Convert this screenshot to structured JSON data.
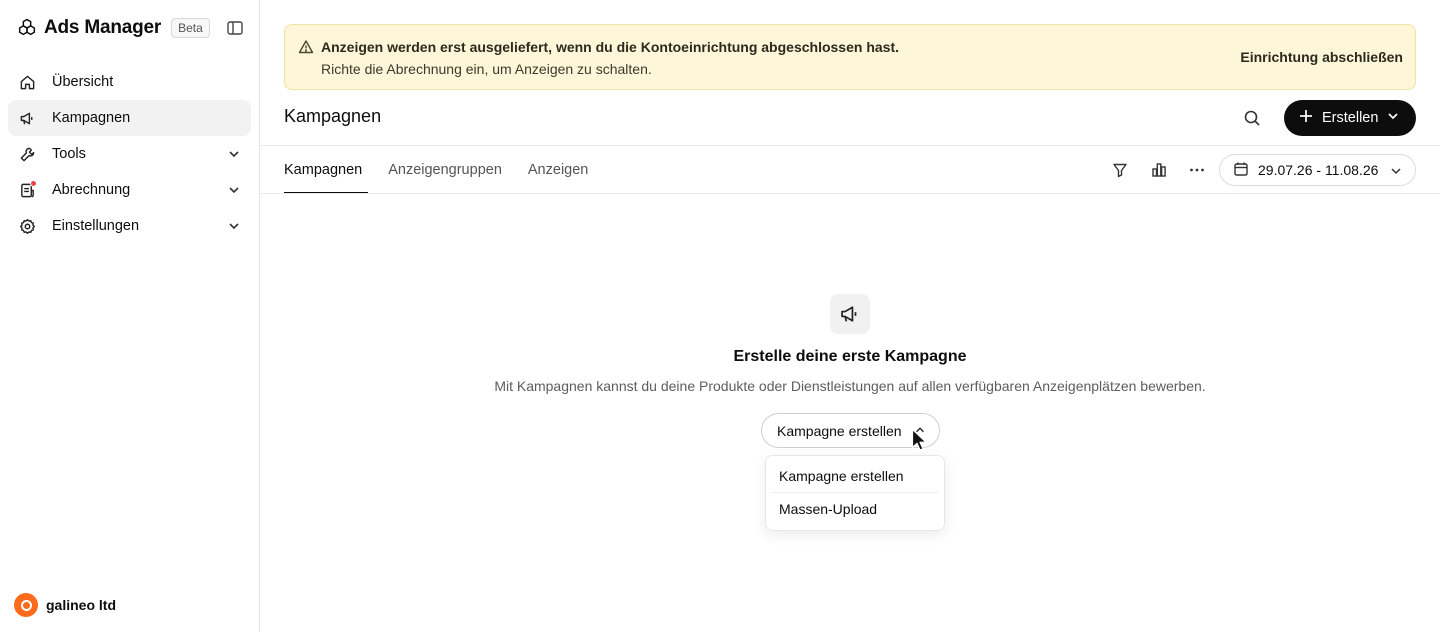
{
  "app": {
    "name": "Ads Manager",
    "badge": "Beta"
  },
  "sidebar": {
    "items": [
      {
        "label": "Übersicht"
      },
      {
        "label": "Kampagnen"
      },
      {
        "label": "Tools"
      },
      {
        "label": "Abrechnung"
      },
      {
        "label": "Einstellungen"
      }
    ],
    "account": "galineo ltd"
  },
  "banner": {
    "title": "Anzeigen werden erst ausgeliefert, wenn du die Kontoeinrichtung abgeschlossen hast.",
    "subtitle": "Richte die Abrechnung ein, um Anzeigen zu schalten.",
    "action": "Einrichtung abschließen"
  },
  "header": {
    "title": "Kampagnen",
    "create_label": "Erstellen"
  },
  "tabs": [
    {
      "label": "Kampagnen"
    },
    {
      "label": "Anzeigengruppen"
    },
    {
      "label": "Anzeigen"
    }
  ],
  "toolbar": {
    "date_range": "29.07.26 - 11.08.26"
  },
  "empty_state": {
    "title": "Erstelle deine erste Kampagne",
    "description": "Mit Kampagnen kannst du deine Produkte oder Dienstleistungen auf allen verfügbaren Anzeigenplätzen bewerben.",
    "cta": "Kampagne erstellen"
  },
  "menu": {
    "items": [
      {
        "label": "Kampagne erstellen"
      },
      {
        "label": "Massen-Upload"
      }
    ]
  },
  "colors": {
    "banner_bg": "#fdf6d8",
    "primary_button": "#0d0d0d",
    "notification_dot": "#e5484d",
    "avatar": "#ff6a1a"
  }
}
